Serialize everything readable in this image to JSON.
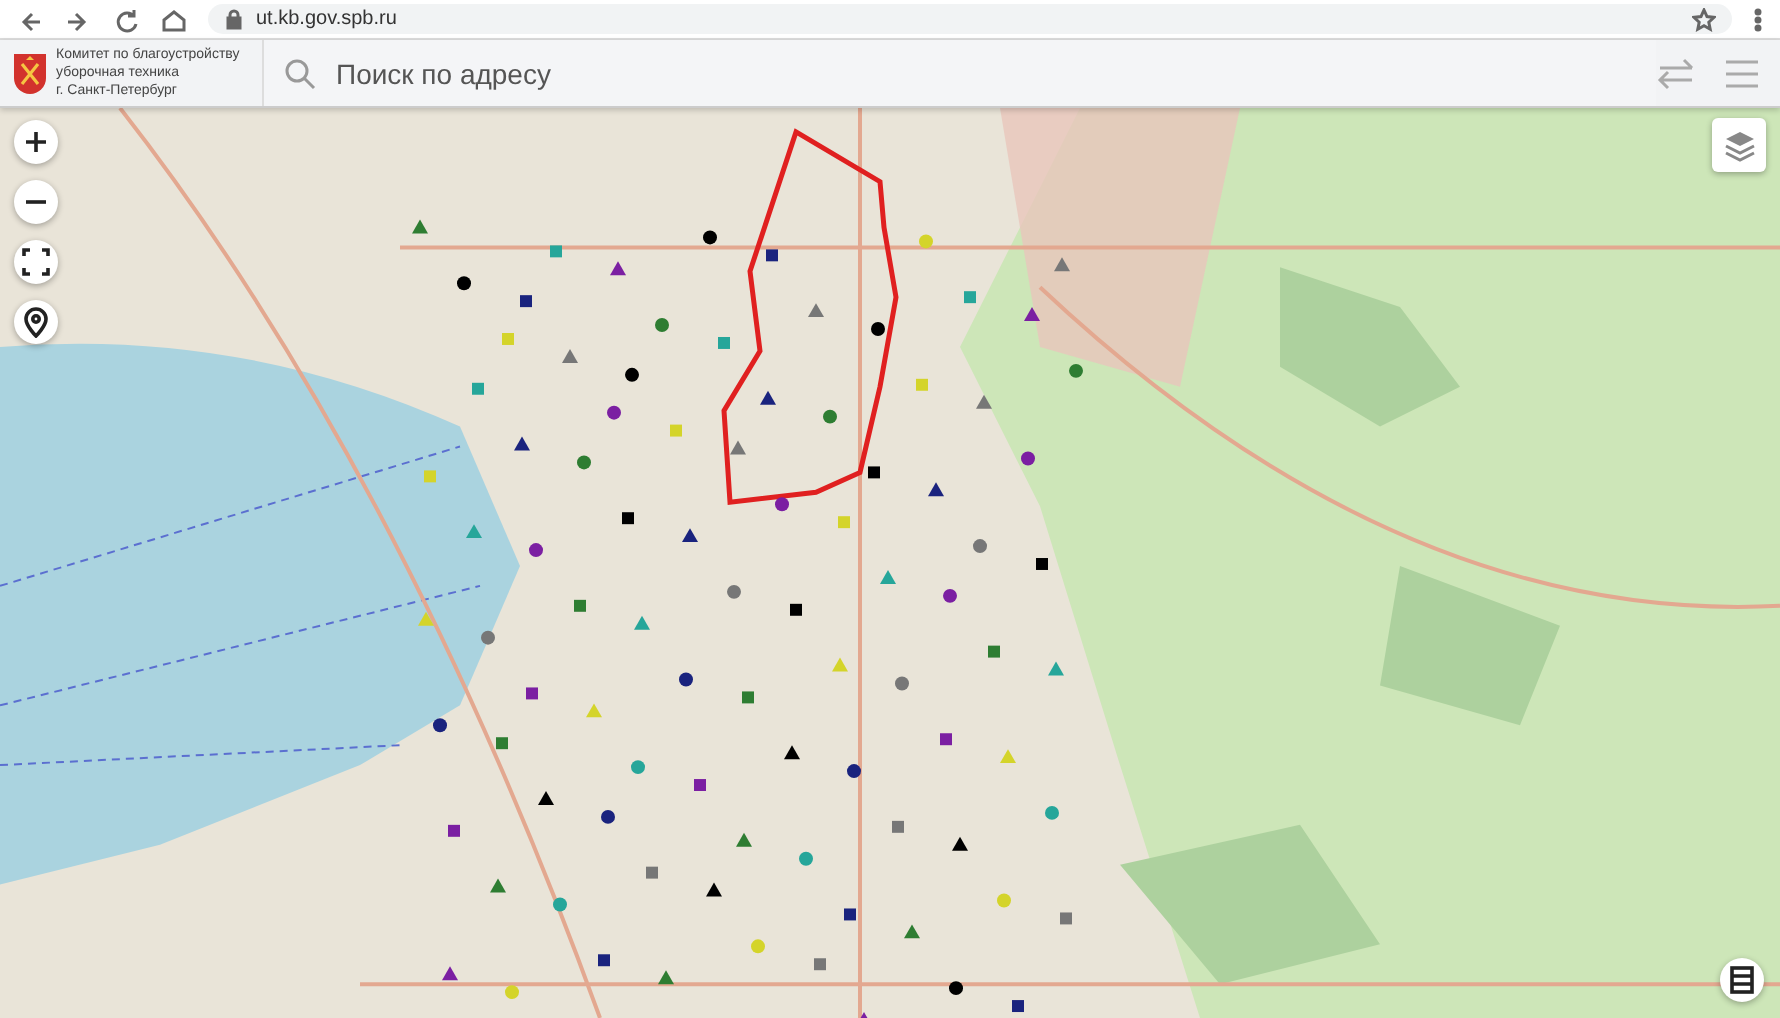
{
  "browser": {
    "url": "ut.kb.gov.spb.ru"
  },
  "header": {
    "org_name": "Комитет по благоустройству\nуборочная техника\nг. Санкт-Петербург",
    "search": {
      "placeholder": "Поиск по адресу"
    }
  },
  "map": {
    "controls": [
      {
        "kind": "zoom-in"
      },
      {
        "kind": "zoom-out"
      },
      {
        "kind": "fullscreen"
      },
      {
        "kind": "locate"
      }
    ]
  }
}
